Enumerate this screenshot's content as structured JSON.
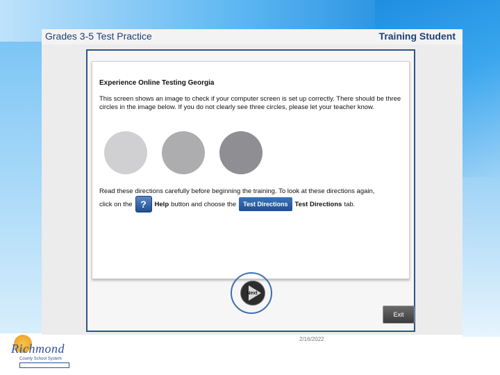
{
  "app": {
    "title": "Grades 3-5 Test Practice",
    "user_name": "Training Student"
  },
  "content": {
    "heading": "Experience Online Testing Georgia",
    "intro": "This screen shows an image to check if your computer screen is set up correctly. There should be three circles in the image below. If you do not clearly see three circles, please let your teacher know.",
    "directions_line1": "Read these directions carefully before beginning the training. To look at these directions again,",
    "directions_click": "click on the",
    "help_label": "Help",
    "directions_mid": "button and choose the",
    "test_directions_button": "Test Directions",
    "test_directions_tab": "Test Directions",
    "directions_end": "tab.",
    "circle_colors": [
      "#d0d0d2",
      "#adadb0",
      "#8f8f93"
    ]
  },
  "controls": {
    "next_label": "Next",
    "exit_label": "Exit"
  },
  "footer": {
    "date": "2/16/2022",
    "logo_name": "Richmond",
    "logo_sub": "County School System"
  },
  "colors": {
    "header_text": "#1d3f78",
    "frame_border": "#2c5488",
    "accent_blue": "#1f4f92"
  }
}
